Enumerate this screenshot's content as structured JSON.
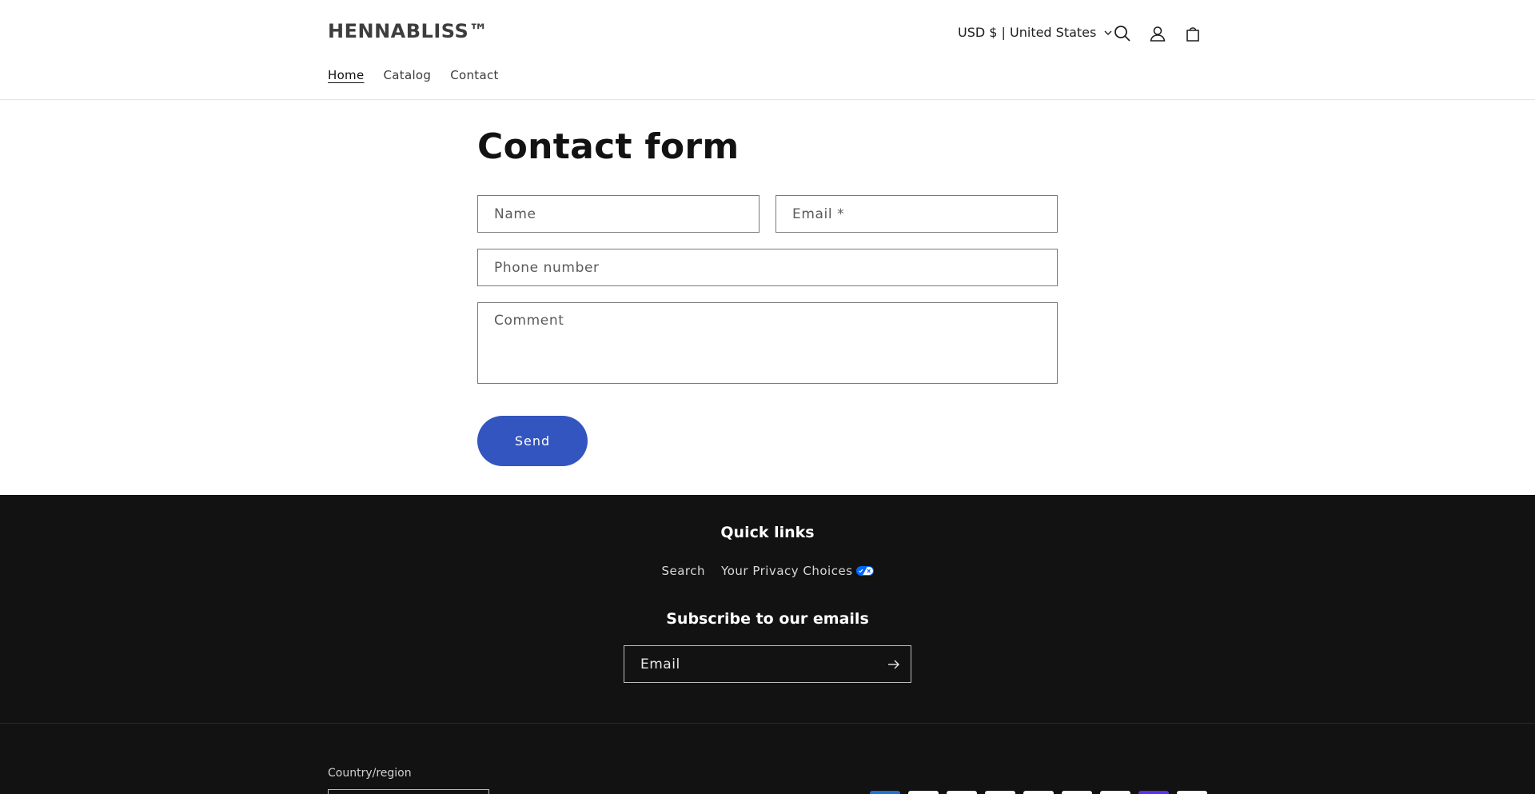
{
  "header": {
    "brand": "HENNABLISS™",
    "currency": "USD $ | United States",
    "nav": [
      {
        "label": "Home"
      },
      {
        "label": "Catalog"
      },
      {
        "label": "Contact"
      }
    ]
  },
  "main": {
    "title": "Contact form",
    "fields": {
      "name": "Name",
      "email": "Email *",
      "phone": "Phone number",
      "comment": "Comment"
    },
    "send_label": "Send"
  },
  "footer": {
    "quick_links_title": "Quick links",
    "links": [
      {
        "label": "Search"
      },
      {
        "label": "Your Privacy Choices"
      }
    ],
    "subscribe_title": "Subscribe to our emails",
    "email_placeholder": "Email",
    "country_label": "Country/region"
  },
  "colors": {
    "accent": "#3355bf",
    "footer_bg": "#121212",
    "privacy_badge": "#0066ff"
  },
  "payment_icons": [
    "american-express-icon",
    "apple-pay-icon",
    "diners-club-icon",
    "discover-icon",
    "google-pay-icon",
    "mastercard-icon",
    "paypal-icon",
    "shop-pay-icon",
    "visa-icon"
  ]
}
